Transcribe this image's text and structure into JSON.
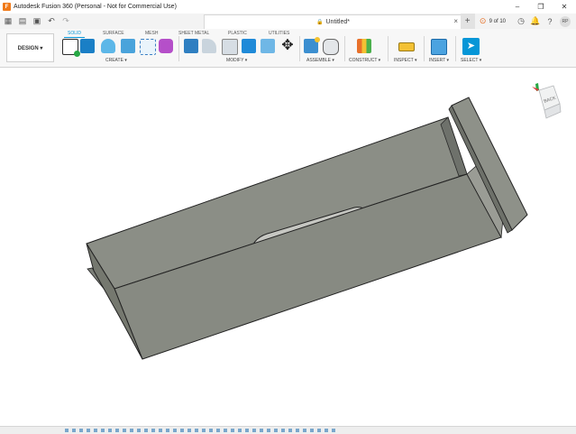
{
  "window": {
    "title": "Autodesk Fusion 360 (Personal - Not for Commercial Use)",
    "minimize_glyph": "–",
    "maximize_glyph": "❐",
    "close_glyph": "✕"
  },
  "tabbar": {
    "doc_title": "Untitled*",
    "close_glyph": "×",
    "plus_glyph": "+",
    "page_count": "9 of 10",
    "user_initials": "RP"
  },
  "ribbon": {
    "workspace_label": "DESIGN ▾",
    "tabs": [
      "SOLID",
      "SURFACE",
      "MESH",
      "SHEET METAL",
      "PLASTIC",
      "UTILITIES"
    ],
    "active_tab": "SOLID",
    "groups": [
      "CREATE ▾",
      "MODIFY ▾",
      "ASSEMBLE ▾",
      "CONSTRUCT ▾",
      "INSPECT ▾",
      "INSERT ▾",
      "SELECT ▾"
    ]
  },
  "viewcube": {
    "face_label": "BACK"
  },
  "colors": {
    "accent": "#0696d7",
    "body_fill": "#8b8e86",
    "body_dark": "#6f716b",
    "edge": "#2a2a2a"
  }
}
